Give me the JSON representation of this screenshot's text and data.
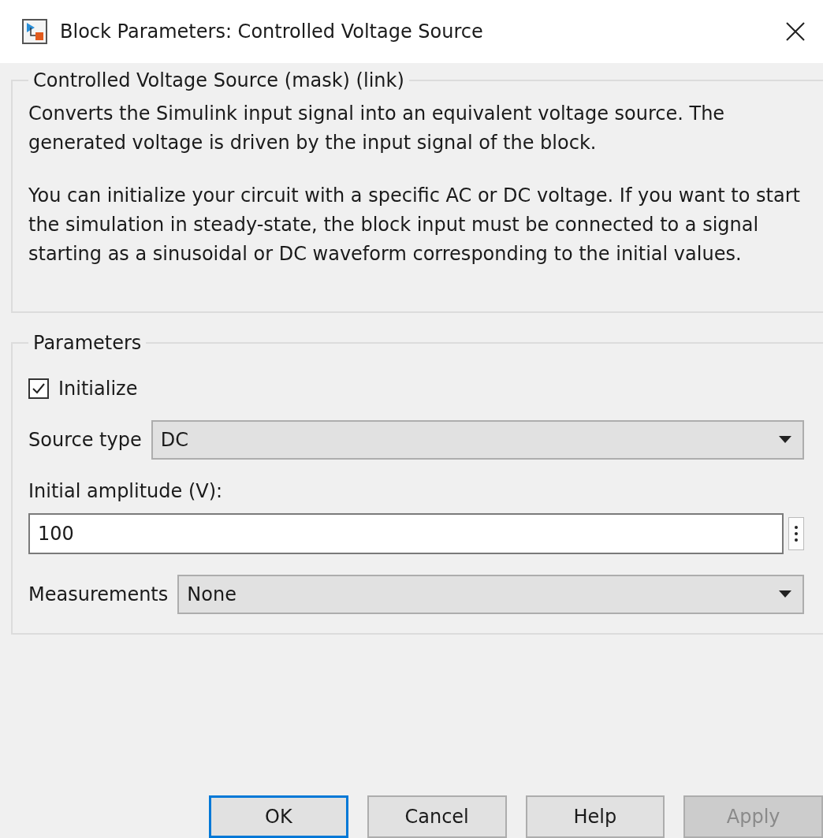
{
  "window": {
    "title": "Block Parameters: Controlled Voltage Source"
  },
  "description_group": {
    "title": "Controlled Voltage Source (mask) (link)",
    "paragraphs": [
      "Converts the Simulink input signal into an equivalent voltage source. The generated voltage is driven by the input signal of the block.",
      "You can initialize your circuit with a specific AC or DC voltage. If you want to start the simulation in steady-state, the block input must be connected to a signal starting as a sinusoidal or DC waveform corresponding to the initial values."
    ]
  },
  "parameters": {
    "title": "Parameters",
    "fields": [
      {
        "kind": "checkbox",
        "label": "Initialize",
        "checked": true
      },
      {
        "kind": "dropdown",
        "label": "Source type",
        "value": "DC"
      },
      {
        "kind": "text",
        "label": "Initial amplitude (V):",
        "value": "100"
      },
      {
        "kind": "dropdown",
        "label": "Measurements",
        "value": "None"
      }
    ]
  },
  "buttons": [
    {
      "label": "OK",
      "focused": true,
      "disabled": false
    },
    {
      "label": "Cancel",
      "focused": false,
      "disabled": false
    },
    {
      "label": "Help",
      "focused": false,
      "disabled": false
    },
    {
      "label": "Apply",
      "focused": false,
      "disabled": true
    }
  ]
}
